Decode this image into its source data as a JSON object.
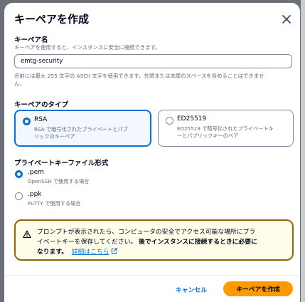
{
  "dialog": {
    "title": "キーペアを作成",
    "close_label": "閉じる"
  },
  "key_name": {
    "label": "キーペア名",
    "description": "キーペアを使用すると、インスタンスに安全に接続できます。",
    "value": "emtg-security",
    "hint_line1": "名前には最大 255 文字の ASCII 文字を使用できます。先頭または末尾のスペースを含めることはできませ",
    "hint_line2": "ん。"
  },
  "key_type": {
    "label": "キーペアのタイプ",
    "options": [
      {
        "title": "RSA",
        "desc_line1": "RSA で暗号化されたプライベートとパブ",
        "desc_line2": "リックのキーペア",
        "selected": true
      },
      {
        "title": "ED25519",
        "desc_line1": "ED25519 で暗号化されたプライベートキ",
        "desc_line2": "ーとパブリックキーのペア",
        "selected": false
      }
    ]
  },
  "file_format": {
    "label": "プライベートキーファイル形式",
    "options": [
      {
        "title": ".pem",
        "desc": "OpenSSH で使用する場合",
        "selected": true
      },
      {
        "title": ".ppk",
        "desc": "PuTTY で使用する場合",
        "selected": false
      }
    ]
  },
  "alert": {
    "line1": "プロンプトが表示されたら、コンピュータの安全でアクセス可能な場所にプラ",
    "line2_plain": "イベートキーを保存してください。",
    "line2_bold": "後でインスタンスに接続するときに必要に",
    "line3_bold": "なります。",
    "link": "詳細はこちら"
  },
  "footer": {
    "cancel_label": "キャンセル",
    "create_label": "キーペアを作成"
  },
  "colors": {
    "primary": "#ff9900",
    "link": "#0972d3",
    "warning_border": "#8d6605",
    "warning_bg": "#fffce9"
  }
}
